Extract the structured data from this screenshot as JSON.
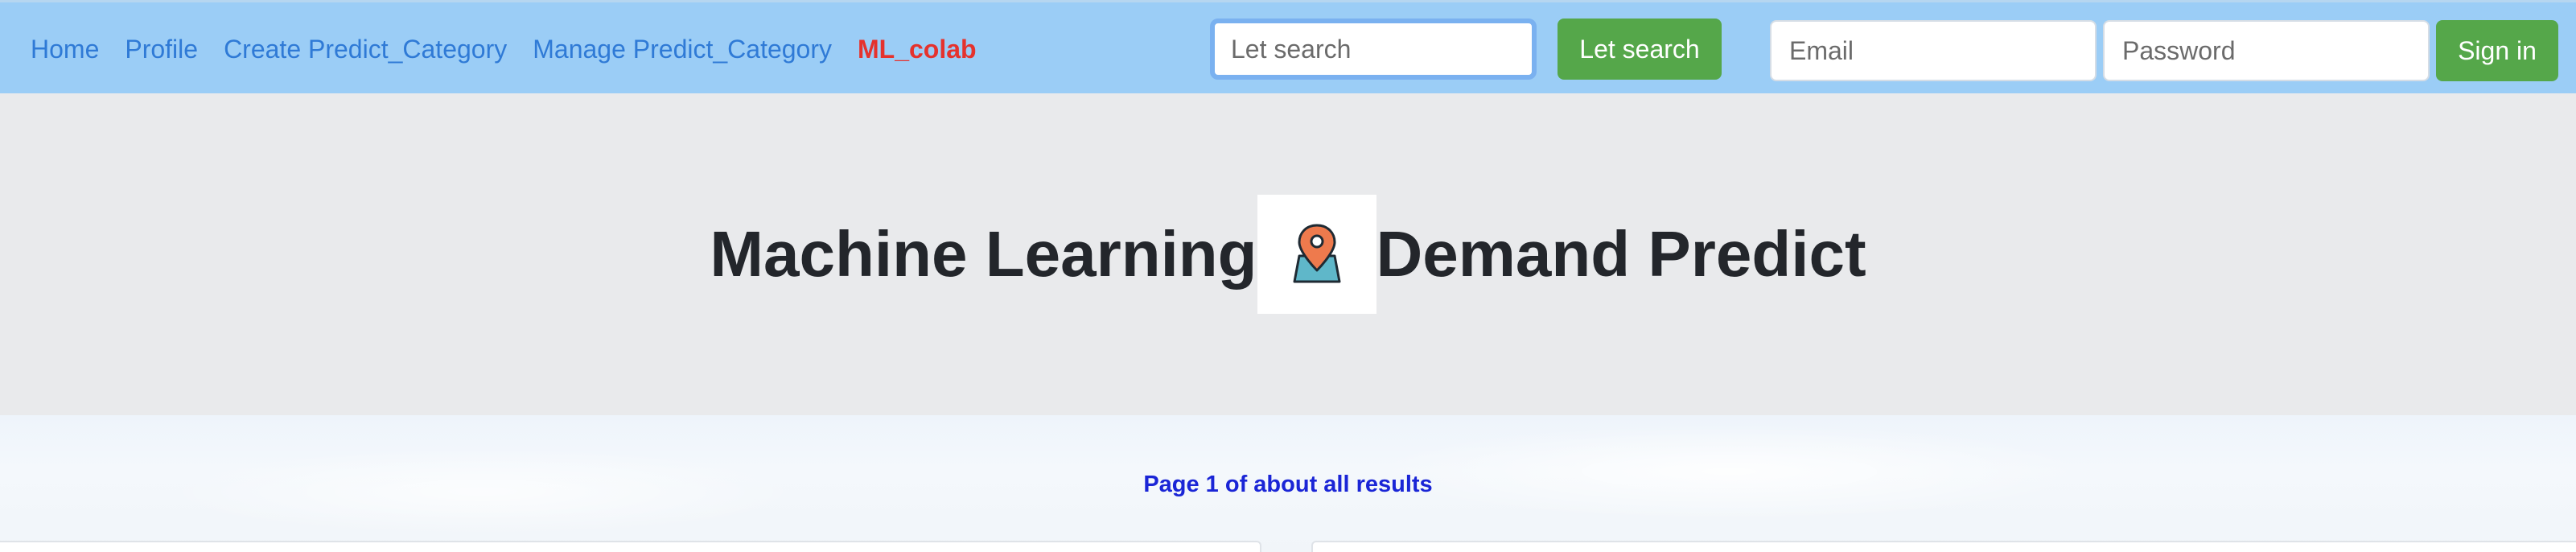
{
  "nav": {
    "links": [
      {
        "label": "Home"
      },
      {
        "label": "Profile"
      },
      {
        "label": "Create Predict_Category"
      },
      {
        "label": "Manage Predict_Category"
      }
    ],
    "brand": "ML_colab",
    "search": {
      "placeholder": "Let search",
      "button_label": "Let search"
    },
    "auth": {
      "email_placeholder": "Email",
      "password_placeholder": "Password",
      "signin_label": "Sign in"
    }
  },
  "hero": {
    "title_left": "Machine Learning",
    "title_right": "Demand Predict",
    "logo_icon": "map-pin-icon"
  },
  "results": {
    "page_info": "Page 1 of about all results"
  },
  "colors": {
    "navbar_bg": "#9bcdf6",
    "link": "#2f7ad6",
    "brand": "#e5322d",
    "button_green": "#55a74a",
    "hero_bg": "#e9eaec",
    "page_info": "#1a25d6"
  }
}
